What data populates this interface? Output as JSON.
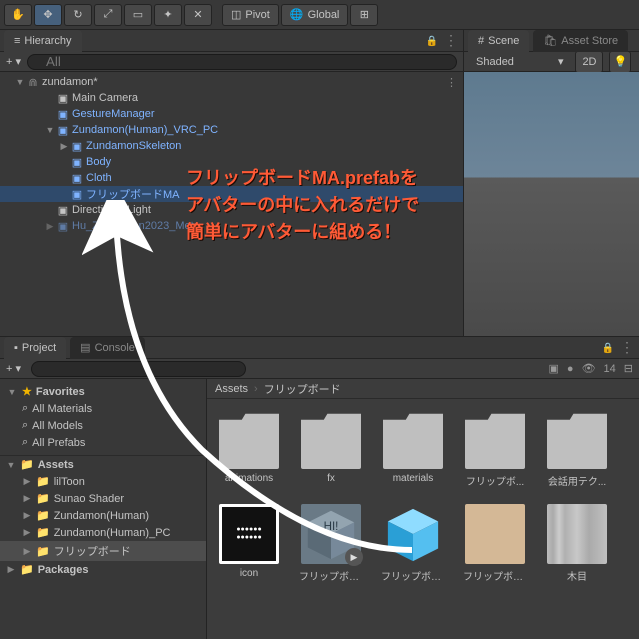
{
  "toolbar": {
    "pivot_label": "Pivot",
    "global_label": "Global"
  },
  "hierarchy": {
    "tab_label": "Hierarchy",
    "search_placeholder": "All",
    "scene_name": "zundamon*",
    "items": [
      {
        "label": "Main Camera",
        "indent": 2,
        "cls": "normal"
      },
      {
        "label": "GestureManager",
        "indent": 2,
        "cls": "prefab-blue"
      },
      {
        "label": "Zundamon(Human)_VRC_PC",
        "indent": 2,
        "cls": "prefab-blue",
        "arrow": "▼"
      },
      {
        "label": "ZundamonSkeleton",
        "indent": 3,
        "cls": "prefab-blue",
        "arrow": "▶"
      },
      {
        "label": "Body",
        "indent": 3,
        "cls": "prefab-blue"
      },
      {
        "label": "Cloth",
        "indent": 3,
        "cls": "prefab-blue"
      },
      {
        "label": "フリップボードMA",
        "indent": 3,
        "cls": "prefab-blue",
        "selected": true
      },
      {
        "label": "Directional Light",
        "indent": 2,
        "cls": "normal"
      },
      {
        "label": "Hu_Zundamon2023_Meta",
        "indent": 2,
        "cls": "prefab-blue",
        "arrow": "▶",
        "dim": true
      }
    ]
  },
  "scene": {
    "tab_scene": "Scene",
    "tab_asset_store": "Asset Store",
    "shaded_label": "Shaded",
    "mode_2d": "2D"
  },
  "project": {
    "tab_project": "Project",
    "tab_console": "Console",
    "search_placeholder": "",
    "count_badge": "14",
    "favorites_label": "Favorites",
    "fav_items": [
      "All Materials",
      "All Models",
      "All Prefabs"
    ],
    "assets_label": "Assets",
    "asset_folders": [
      "lilToon",
      "Sunao Shader",
      "Zundamon(Human)",
      "Zundamon(Human)_PC",
      "フリップボード"
    ],
    "packages_label": "Packages",
    "breadcrumb": [
      "Assets",
      "フリップボード"
    ],
    "grid_items": [
      {
        "label": "animations",
        "type": "folder"
      },
      {
        "label": "fx",
        "type": "folder"
      },
      {
        "label": "materials",
        "type": "folder"
      },
      {
        "label": "フリップボ...",
        "type": "folder"
      },
      {
        "label": "会話用テク...",
        "type": "folder"
      },
      {
        "label": "icon",
        "type": "icon-black"
      },
      {
        "label": "フリップボード",
        "type": "prefab-gray"
      },
      {
        "label": "フリップボー...",
        "type": "prefab-cyan"
      },
      {
        "label": "フリップボード...",
        "type": "tan"
      },
      {
        "label": "木目",
        "type": "wood"
      }
    ]
  },
  "annotation": {
    "line1": "フリップボードMA.prefabを",
    "line2": "アバターの中に入れるだけで",
    "line3": "簡単にアバターに組める！"
  }
}
